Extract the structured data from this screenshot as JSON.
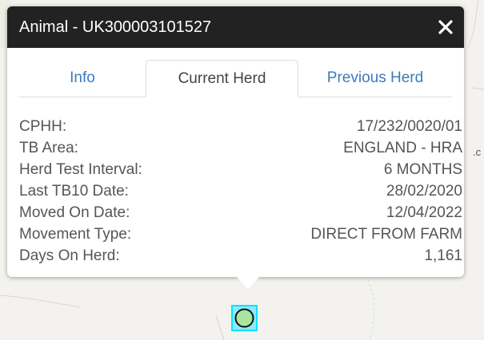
{
  "popup": {
    "title": "Animal - UK300003101527",
    "close_icon": "close-icon"
  },
  "tabs": [
    {
      "label": "Info",
      "active": false
    },
    {
      "label": "Current Herd",
      "active": true
    },
    {
      "label": "Previous Herd",
      "active": false
    }
  ],
  "details": [
    {
      "label": "CPHH:",
      "value": "17/232/0020/01"
    },
    {
      "label": "TB Area:",
      "value": "ENGLAND - HRA"
    },
    {
      "label": "Herd Test Interval:",
      "value": "6 MONTHS"
    },
    {
      "label": "Last TB10 Date:",
      "value": "28/02/2020"
    },
    {
      "label": "Moved On Date:",
      "value": "12/04/2022"
    },
    {
      "label": "Movement Type:",
      "value": "DIRECT FROM FARM"
    },
    {
      "label": "Days On Herd:",
      "value": "1,161"
    }
  ],
  "map": {
    "edge_text": ".c",
    "marker_icon": "circle-marker-icon"
  },
  "colors": {
    "header_bg": "#222222",
    "tab_link": "#3a7bbf",
    "marker_border": "#00e5ff",
    "marker_fill": "#a8e6a0"
  }
}
